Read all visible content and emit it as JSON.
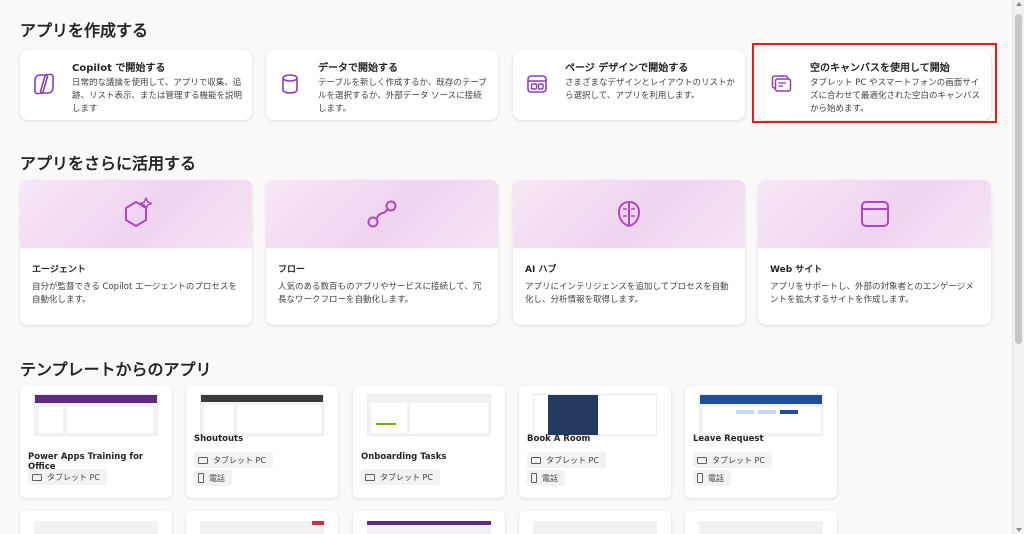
{
  "sections": {
    "create_title": "アプリを作成する",
    "use_title": "アプリをさらに活用する",
    "templates_title": "テンプレートからのアプリ"
  },
  "create_cards": [
    {
      "title": "Copilot で開始する",
      "desc": "日常的な議論を使用して、アプリで収集、追跡、リスト表示、または管理する機能を説明します",
      "icon": "copilot-icon"
    },
    {
      "title": "データで開始する",
      "desc": "テーブルを新しく作成するか、既存のテーブルを選択するか、外部データ ソースに接続します。",
      "icon": "database-icon"
    },
    {
      "title": "ページ デザインで開始する",
      "desc": "さまざまなデザインとレイアウトのリストから選択して、アプリを利用します。",
      "icon": "page-design-icon"
    },
    {
      "title": "空のキャンバスを使用して開始",
      "desc": "タブレット PC やスマートフォンの画面サイズに合わせて最適化された空白のキャンバスから始めます。",
      "icon": "blank-canvas-icon"
    }
  ],
  "use_cards": [
    {
      "title": "エージェント",
      "desc": "自分が監督できる Copilot エージェントのプロセスを自動化します。",
      "icon": "agent-sparkle-icon"
    },
    {
      "title": "フロー",
      "desc": "人気のある数百ものアプリやサービスに接続して、冗長なワークフローを自動化します。",
      "icon": "flow-icon"
    },
    {
      "title": "AI ハブ",
      "desc": "アプリにインテリジェンスを追加してプロセスを自動化し、分析情報を取得します。",
      "icon": "ai-brain-icon"
    },
    {
      "title": "Web サイト",
      "desc": "アプリをサポートし、外部の対象者とのエンゲージメントを拡大するサイトを作成します。",
      "icon": "web-window-icon"
    }
  ],
  "templates": [
    {
      "name": "Power Apps Training for Office",
      "tags": [
        "タブレット PC"
      ]
    },
    {
      "name": "Shoutouts",
      "tags": [
        "タブレット PC",
        "電話"
      ]
    },
    {
      "name": "Onboarding Tasks",
      "tags": [
        "タブレット PC"
      ]
    },
    {
      "name": "Book A Room",
      "tags": [
        "タブレット PC",
        "電話"
      ]
    },
    {
      "name": "Leave Request",
      "tags": [
        "タブレット PC",
        "電話"
      ]
    }
  ],
  "colors": {
    "accent_purple": "#b146c2",
    "highlight_red": "#e01e1e"
  }
}
